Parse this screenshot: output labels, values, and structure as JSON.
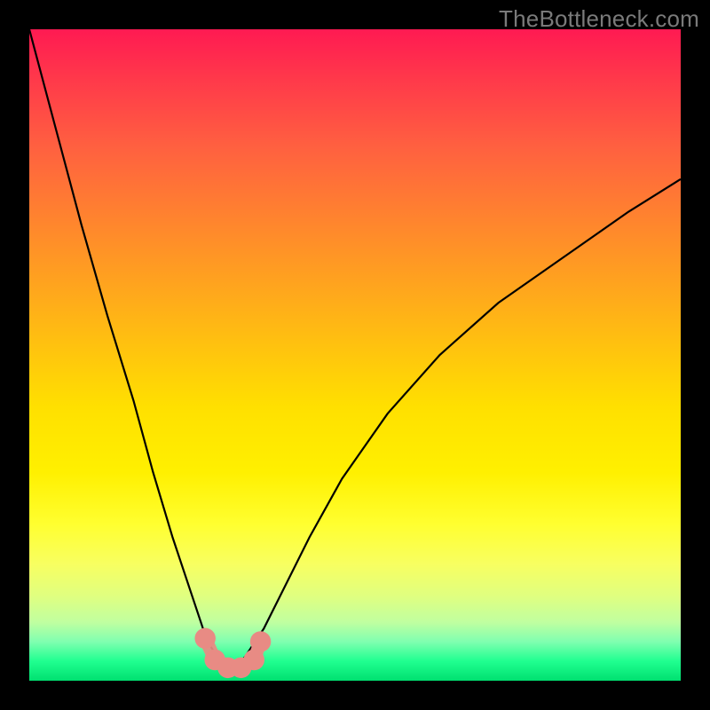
{
  "attribution": "TheBottleneck.com",
  "chart_data": {
    "type": "line",
    "title": "",
    "xlabel": "",
    "ylabel": "",
    "xlim": [
      0,
      100
    ],
    "ylim": [
      0,
      100
    ],
    "grid": false,
    "legend": false,
    "annotations": [],
    "series": [
      {
        "name": "curve",
        "color": "#000000",
        "x": [
          0,
          4,
          8,
          12,
          16,
          19,
          22,
          25,
          27,
          28,
          29,
          30,
          31,
          32,
          33,
          34,
          36,
          39,
          43,
          48,
          55,
          63,
          72,
          82,
          92,
          100
        ],
        "y": [
          100,
          85,
          70,
          56,
          43,
          32,
          22,
          13,
          7,
          5,
          3.5,
          2.8,
          2.6,
          2.8,
          3.5,
          5,
          8,
          14,
          22,
          31,
          41,
          50,
          58,
          65,
          72,
          77
        ]
      },
      {
        "name": "markers",
        "color": "#e88b84",
        "type": "scatter",
        "x": [
          27.0,
          28.5,
          30.5,
          32.5,
          34.5,
          35.5
        ],
        "y": [
          6.5,
          3.2,
          2.0,
          2.0,
          3.2,
          6.0
        ]
      }
    ],
    "background_gradient_stops": [
      {
        "pos": 0.0,
        "color": "#ff1a52"
      },
      {
        "pos": 0.5,
        "color": "#ffc010"
      },
      {
        "pos": 0.75,
        "color": "#ffff30"
      },
      {
        "pos": 0.95,
        "color": "#80ffb0"
      },
      {
        "pos": 1.0,
        "color": "#00e070"
      }
    ]
  }
}
